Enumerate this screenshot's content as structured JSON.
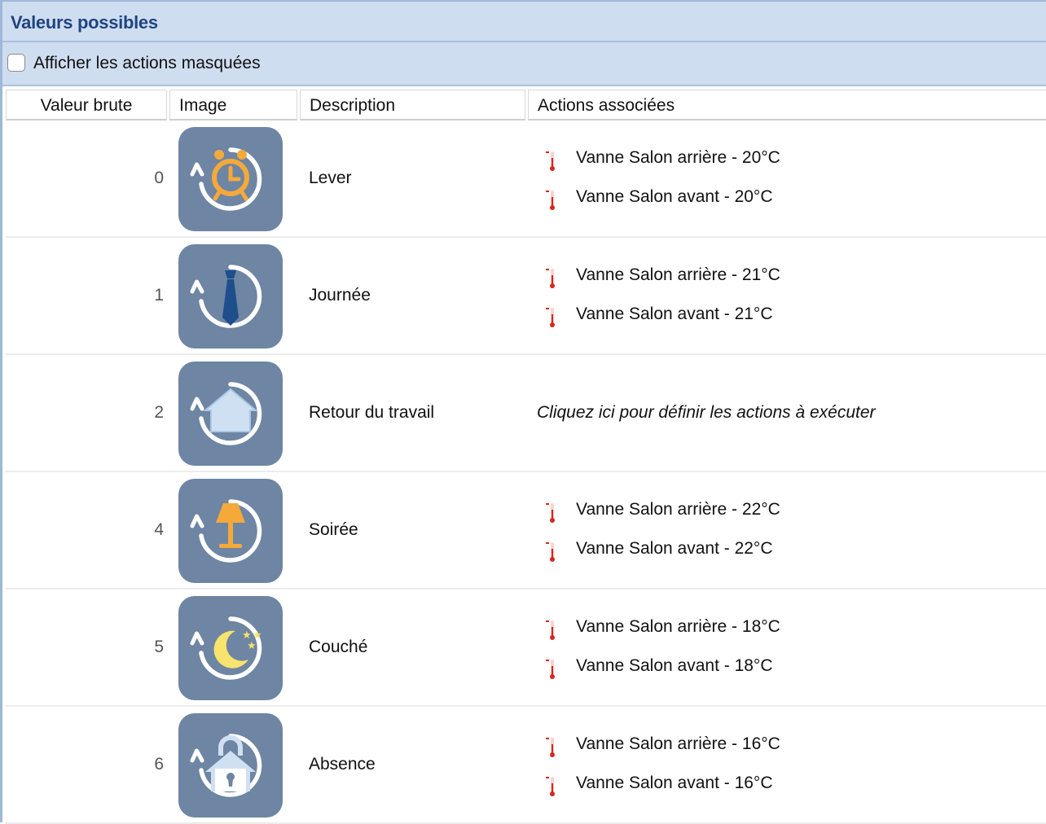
{
  "panel": {
    "title": "Valeurs possibles",
    "show_hidden_label": "Afficher les actions masquées",
    "show_hidden_checked": false
  },
  "columns": [
    "Valeur brute",
    "Image",
    "Description",
    "Actions associées"
  ],
  "colors": {
    "header_bg": "#cfddf0",
    "title_color": "#1f4480",
    "icon_bg": "#6e85a3",
    "thermometer": "#d9261c"
  },
  "rows": [
    {
      "value": "0",
      "icon": "alarm-clock-icon",
      "description": "Lever",
      "actions": [
        "Vanne Salon arrière - 20°C",
        "Vanne Salon avant - 20°C"
      ]
    },
    {
      "value": "1",
      "icon": "necktie-icon",
      "description": "Journée",
      "actions": [
        "Vanne Salon arrière - 21°C",
        "Vanne Salon avant - 21°C"
      ]
    },
    {
      "value": "2",
      "icon": "house-icon",
      "description": "Retour du travail",
      "actions": [],
      "empty_actions": "Cliquez ici pour définir les actions à exécuter"
    },
    {
      "value": "4",
      "icon": "lamp-icon",
      "description": "Soirée",
      "actions": [
        "Vanne Salon arrière - 22°C",
        "Vanne Salon avant - 22°C"
      ]
    },
    {
      "value": "5",
      "icon": "moon-stars-icon",
      "description": "Couché",
      "actions": [
        "Vanne Salon arrière - 18°C",
        "Vanne Salon avant - 18°C"
      ]
    },
    {
      "value": "6",
      "icon": "locked-house-icon",
      "description": "Absence",
      "actions": [
        "Vanne Salon arrière - 16°C",
        "Vanne Salon avant - 16°C"
      ]
    }
  ]
}
